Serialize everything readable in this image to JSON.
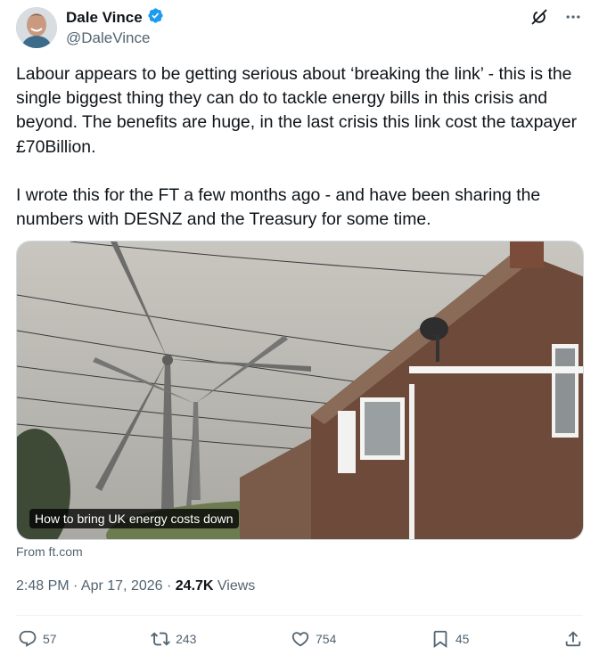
{
  "author": {
    "name": "Dale Vince",
    "handle": "@DaleVince",
    "verified": true
  },
  "tweet": {
    "paragraphs": [
      "Labour appears to be getting serious about ‘breaking the link’ - this is the single biggest thing they can do to tackle energy bills in this crisis and beyond. The benefits are huge, in the last crisis this link cost the taxpayer £70Billion.",
      "I wrote this for the FT a few months ago - and have been sharing the numbers with DESNZ and the Treasury for some time."
    ]
  },
  "card": {
    "title": "How to bring UK energy costs down",
    "source": "From ft.com"
  },
  "meta": {
    "time": "2:48 PM · Apr 17, 2026 · ",
    "views_count": "24.7K",
    "views_label": " Views"
  },
  "actions": {
    "replies": "57",
    "reposts": "243",
    "likes": "754",
    "bookmarks": "45"
  },
  "colors": {
    "accent": "#1d9bf0",
    "text": "#0f1419",
    "secondary": "#536471"
  }
}
